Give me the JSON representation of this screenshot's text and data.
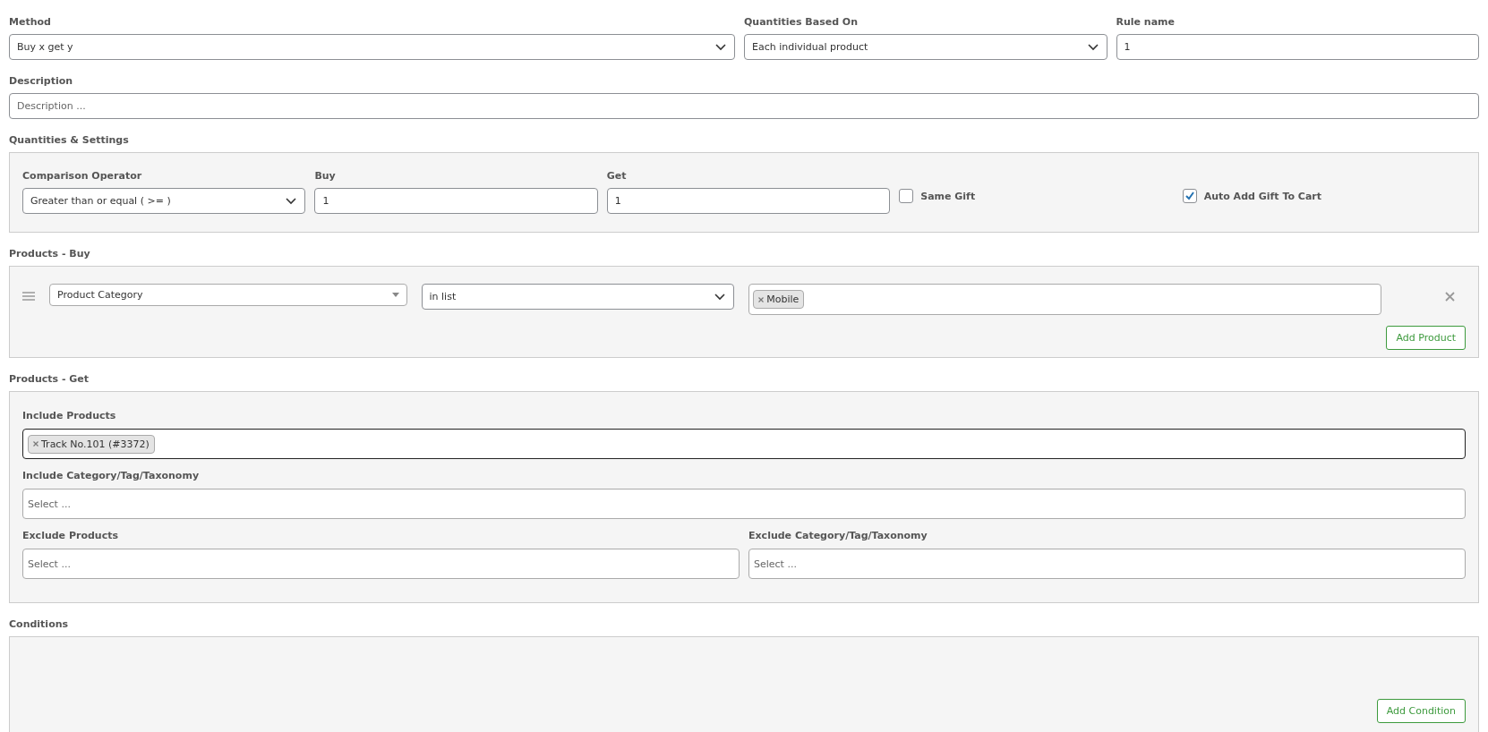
{
  "top_fields": [
    {
      "kind": "select",
      "label": "Method",
      "value": "Buy x get y"
    },
    {
      "kind": "select",
      "label": "Quantities Based On",
      "value": "Each individual product"
    },
    {
      "kind": "text",
      "label": "Rule name",
      "value": "1"
    }
  ],
  "description": {
    "label": "Description",
    "placeholder": "Description ..."
  },
  "quantities_settings": {
    "title": "Quantities & Settings",
    "fields": [
      {
        "kind": "select",
        "label": "Comparison Operator",
        "value": "Greater than or equal ( >= )"
      },
      {
        "kind": "text",
        "label": "Buy",
        "value": "1"
      },
      {
        "kind": "text",
        "label": "Get",
        "value": "1"
      }
    ],
    "options": [
      {
        "label": "Same Gift",
        "checked": false
      },
      {
        "label": "Auto Add Gift To Cart",
        "checked": true
      }
    ]
  },
  "products_buy": {
    "title": "Products - Buy",
    "rules": [
      {
        "type": "Product Category",
        "operator": "in list",
        "tags": [
          "Mobile"
        ]
      }
    ],
    "add_button": "Add Product"
  },
  "products_get": {
    "title": "Products - Get",
    "rows": [
      [
        {
          "label": "Include Products",
          "tags": [
            "Track No.101 (#3372)"
          ],
          "focused": true
        }
      ],
      [
        {
          "label": "Include Category/Tag/Taxonomy",
          "placeholder": "Select ...",
          "focused": false
        }
      ],
      [
        {
          "label": "Exclude Products",
          "placeholder": "Select ...",
          "focused": false
        },
        {
          "label": "Exclude Category/Tag/Taxonomy",
          "placeholder": "Select ...",
          "focused": false
        }
      ]
    ]
  },
  "conditions": {
    "title": "Conditions",
    "add_button": "Add Condition"
  }
}
